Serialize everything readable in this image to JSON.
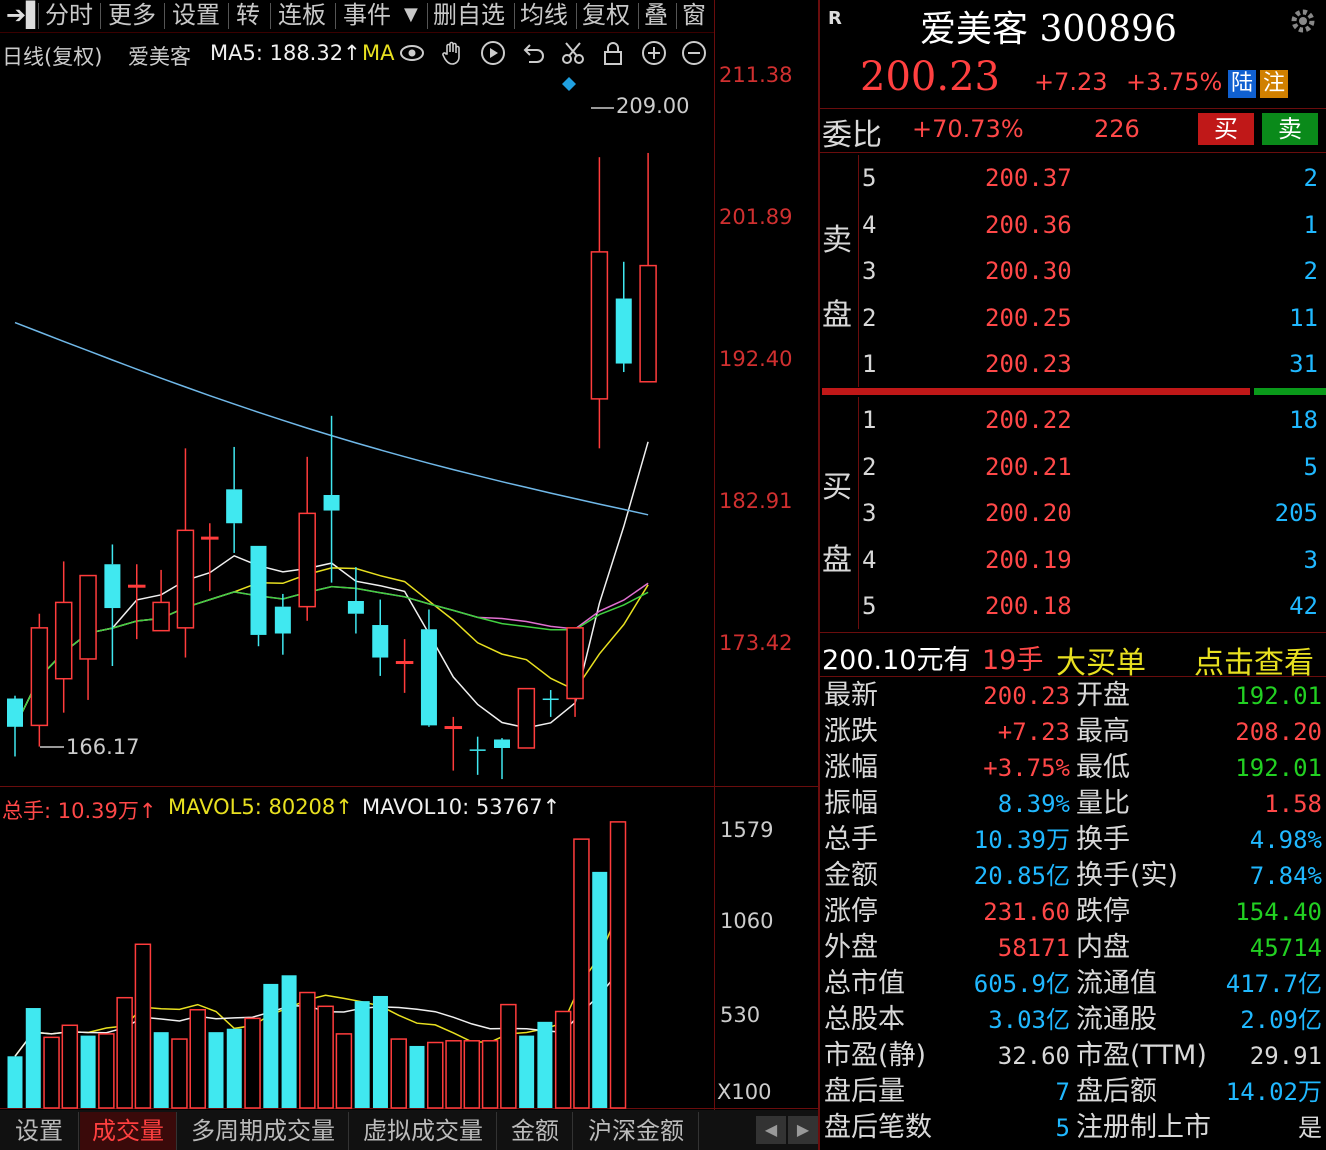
{
  "toolbar": {
    "items": [
      "分时",
      "更多",
      "设置",
      "转",
      "连板",
      "事件",
      "删自选",
      "均线",
      "复权",
      "叠",
      "窗"
    ]
  },
  "chart": {
    "period_label": "日线(复权)",
    "stock_name": "爱美客",
    "ma5_label": "MA5: 188.32↑",
    "ma_label": "MA",
    "high_marker": "209.00",
    "low_marker": "166.17",
    "y_ticks": [
      "211.38",
      "201.89",
      "192.40",
      "182.91",
      "173.42"
    ]
  },
  "volume": {
    "total_label": "总手: 10.39万↑",
    "mavol5_label": "MAVOL5: 80208↑",
    "mavol10_label": "MAVOL10: 53767↑",
    "y_ticks": [
      "1579",
      "1060",
      "530"
    ],
    "multiplier": "X100"
  },
  "chart_data": {
    "type": "candlestick",
    "candles": [
      {
        "o": 169.6,
        "c": 167.6,
        "h": 169.8,
        "l": 165.5
      },
      {
        "o": 167.7,
        "c": 174.6,
        "h": 175.6,
        "l": 166.2
      },
      {
        "o": 171.0,
        "c": 176.4,
        "h": 179.3,
        "l": 168.6
      },
      {
        "o": 172.4,
        "c": 178.3,
        "h": 178.3,
        "l": 169.5
      },
      {
        "o": 179.1,
        "c": 176.0,
        "h": 180.5,
        "l": 171.9
      },
      {
        "o": 177.5,
        "c": 177.6,
        "h": 179.1,
        "l": 173.8
      },
      {
        "o": 174.4,
        "c": 176.4,
        "h": 178.7,
        "l": 174.4
      },
      {
        "o": 174.6,
        "c": 181.5,
        "h": 187.3,
        "l": 172.5
      },
      {
        "o": 181.0,
        "c": 181.0,
        "h": 182.0,
        "l": 177.2
      },
      {
        "o": 184.4,
        "c": 182.0,
        "h": 187.4,
        "l": 179.9
      },
      {
        "o": 180.4,
        "c": 174.1,
        "h": 180.4,
        "l": 173.3
      },
      {
        "o": 176.1,
        "c": 174.2,
        "h": 177.0,
        "l": 172.7
      },
      {
        "o": 176.1,
        "c": 182.7,
        "h": 186.7,
        "l": 175.1
      },
      {
        "o": 184.0,
        "c": 182.9,
        "h": 189.6,
        "l": 177.8
      },
      {
        "o": 176.5,
        "c": 175.6,
        "h": 178.9,
        "l": 174.2
      },
      {
        "o": 174.8,
        "c": 172.5,
        "h": 176.6,
        "l": 171.2
      },
      {
        "o": 172.2,
        "c": 172.2,
        "h": 173.8,
        "l": 170.0
      },
      {
        "o": 174.5,
        "c": 167.7,
        "h": 175.9,
        "l": 167.6
      },
      {
        "o": 167.6,
        "c": 167.6,
        "h": 168.3,
        "l": 164.5
      },
      {
        "o": 166.0,
        "c": 165.9,
        "h": 166.9,
        "l": 164.2
      },
      {
        "o": 166.7,
        "c": 166.1,
        "h": 166.8,
        "l": 163.9
      },
      {
        "o": 166.1,
        "c": 170.3,
        "h": 170.3,
        "l": 166.1
      },
      {
        "o": 169.6,
        "c": 169.5,
        "h": 170.2,
        "l": 168.3
      },
      {
        "o": 169.6,
        "c": 174.6,
        "h": 174.6,
        "l": 168.3
      },
      {
        "o": 190.8,
        "c": 201.2,
        "h": 207.9,
        "l": 187.3
      },
      {
        "o": 197.9,
        "c": 193.3,
        "h": 200.5,
        "l": 192.7
      },
      {
        "o": 192.01,
        "c": 200.23,
        "h": 208.2,
        "l": 192.01
      }
    ],
    "volumes": [
      300,
      580,
      410,
      480,
      420,
      430,
      640,
      950,
      440,
      400,
      570,
      440,
      460,
      520,
      720,
      770,
      670,
      590,
      430,
      620,
      650,
      400,
      360,
      380,
      390,
      390,
      390,
      600,
      420,
      500,
      560,
      1560,
      1370,
      1660
    ],
    "ylim": [
      166.17,
      211.38
    ],
    "vol_ylim": [
      0,
      1700
    ]
  },
  "quote": {
    "badge": "R",
    "title": "爱美客 300896",
    "price": "200.23",
    "change": "+7.23",
    "change_pct": "+3.75%",
    "tag1": "陆",
    "tag2": "注",
    "ratio_label": "委比",
    "ratio_value": "+70.73%",
    "ratio_diff": "226",
    "buy_btn": "买",
    "sell_btn": "卖",
    "sell_side_label": [
      "卖",
      "盘"
    ],
    "buy_side_label": [
      "买",
      "盘"
    ],
    "asks": [
      {
        "lvl": "5",
        "price": "200.37",
        "vol": "2"
      },
      {
        "lvl": "4",
        "price": "200.36",
        "vol": "1"
      },
      {
        "lvl": "3",
        "price": "200.30",
        "vol": "2"
      },
      {
        "lvl": "2",
        "price": "200.25",
        "vol": "11"
      },
      {
        "lvl": "1",
        "price": "200.23",
        "vol": "31"
      }
    ],
    "bids": [
      {
        "lvl": "1",
        "price": "200.22",
        "vol": "18"
      },
      {
        "lvl": "2",
        "price": "200.21",
        "vol": "5"
      },
      {
        "lvl": "3",
        "price": "200.20",
        "vol": "205"
      },
      {
        "lvl": "4",
        "price": "200.19",
        "vol": "3"
      },
      {
        "lvl": "5",
        "price": "200.18",
        "vol": "42"
      }
    ],
    "bigorder_price": "200.10元有",
    "bigorder_qty": "19手",
    "bigorder_text": "大买单",
    "bigorder_link": "点击查看",
    "stats": [
      {
        "l1": "最新",
        "v1": "200.23",
        "c1": "#ff4848",
        "l2": "开盘",
        "v2": "192.01",
        "c2": "#22d022"
      },
      {
        "l1": "涨跌",
        "v1": "+7.23",
        "c1": "#ff4848",
        "l2": "最高",
        "v2": "208.20",
        "c2": "#ff4848"
      },
      {
        "l1": "涨幅",
        "v1": "+3.75%",
        "c1": "#ff4848",
        "l2": "最低",
        "v2": "192.01",
        "c2": "#22d022"
      },
      {
        "l1": "振幅",
        "v1": "8.39%",
        "c1": "#20b8ff",
        "l2": "量比",
        "v2": "1.58",
        "c2": "#ff4848"
      },
      {
        "l1": "总手",
        "v1": "10.39万",
        "c1": "#20b8ff",
        "l2": "换手",
        "v2": "4.98%",
        "c2": "#20b8ff"
      },
      {
        "l1": "金额",
        "v1": "20.85亿",
        "c1": "#20b8ff",
        "l2": "换手(实)",
        "v2": "7.84%",
        "c2": "#20b8ff"
      },
      {
        "l1": "涨停",
        "v1": "231.60",
        "c1": "#ff4848",
        "l2": "跌停",
        "v2": "154.40",
        "c2": "#22d022"
      },
      {
        "l1": "外盘",
        "v1": "58171",
        "c1": "#ff4848",
        "l2": "内盘",
        "v2": "45714",
        "c2": "#22d022"
      },
      {
        "l1": "总市值",
        "v1": "605.9亿",
        "c1": "#20b8ff",
        "l2": "流通值",
        "v2": "417.7亿",
        "c2": "#20b8ff"
      },
      {
        "l1": "总股本",
        "v1": "3.03亿",
        "c1": "#20b8ff",
        "l2": "流通股",
        "v2": "2.09亿",
        "c2": "#20b8ff"
      },
      {
        "l1": "市盈(静)",
        "v1": "32.60",
        "c1": "#d8d8d8",
        "l2": "市盈(TTM)",
        "v2": "29.91",
        "c2": "#d8d8d8"
      },
      {
        "l1": "盘后量",
        "v1": "7",
        "c1": "#20b8ff",
        "l2": "盘后额",
        "v2": "14.02万",
        "c2": "#20b8ff"
      },
      {
        "l1": "盘后笔数",
        "v1": "5",
        "c1": "#20b8ff",
        "l2": "注册制上市",
        "v2": "是",
        "c2": "#d8d8d8"
      }
    ]
  },
  "tabs": [
    "设置",
    "成交量",
    "多周期成交量",
    "虚拟成交量",
    "金额",
    "沪深金额"
  ]
}
